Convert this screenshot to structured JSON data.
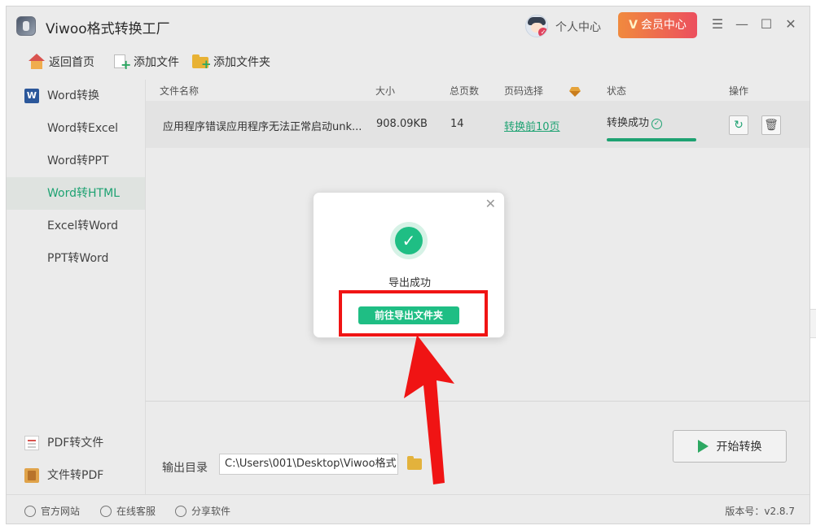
{
  "window": {
    "title": "Viwoo格式转换工厂",
    "personal_center": "个人中心",
    "vip_center": "会员中心",
    "vip_mark": "V"
  },
  "toolbar": {
    "home": "返回首页",
    "add_file": "添加文件",
    "add_folder": "添加文件夹"
  },
  "sidebar": {
    "items": [
      {
        "label": "Word转换"
      },
      {
        "label": "Word转Excel"
      },
      {
        "label": "Word转PPT"
      },
      {
        "label": "Word转HTML"
      },
      {
        "label": "Excel转Word"
      },
      {
        "label": "PPT转Word"
      }
    ],
    "bottom_items": [
      {
        "label": "PDF转文件"
      },
      {
        "label": "文件转PDF"
      }
    ]
  },
  "table": {
    "headers": {
      "name": "文件名称",
      "size": "大小",
      "pages": "总页数",
      "page_select": "页码选择",
      "status": "状态",
      "ops": "操作"
    },
    "rows": [
      {
        "name": "应用程序错误应用程序无法正常启动unk...",
        "size": "908.09KB",
        "pages": "14",
        "page_select": "转换前10页",
        "status": "转换成功",
        "progress": 1.0
      }
    ]
  },
  "output": {
    "label": "输出目录",
    "path": "C:\\Users\\001\\Desktop\\Viwoo格式 •••"
  },
  "start_button": "开始转换",
  "footer": {
    "website": "官方网站",
    "support": "在线客服",
    "share": "分享软件",
    "version": "版本号：v2.8.7"
  },
  "modal": {
    "message": "导出成功",
    "button": "前往导出文件夹"
  },
  "colors": {
    "accent": "#1ea272",
    "success": "#1fbe84",
    "vip_gradient_start": "#f08a3e",
    "vip_gradient_end": "#ec4f5e",
    "annotation": "#f01414"
  }
}
